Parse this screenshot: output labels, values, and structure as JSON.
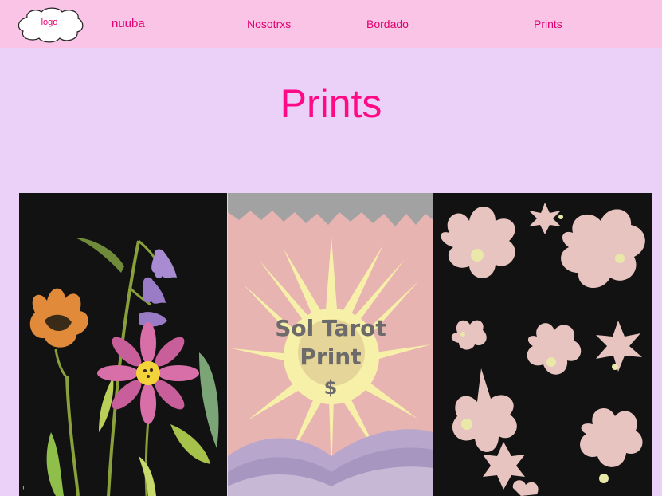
{
  "header": {
    "logo_text": "logo",
    "brand": "nuuba",
    "nav": {
      "nosotrxs": "Nosotrxs",
      "bordado": "Bordado",
      "prints": "Prints"
    }
  },
  "main": {
    "title": "Prints",
    "products": [
      {
        "image": "wildflowers-print"
      },
      {
        "image": "sun-tarot-print",
        "name": "Sol Tarot Print",
        "price": "$"
      },
      {
        "image": "pink-flowers-print"
      }
    ]
  },
  "colors": {
    "header_bg": "#f9c4e6",
    "page_bg": "#ebd0f8",
    "accent": "#ff0a84"
  }
}
